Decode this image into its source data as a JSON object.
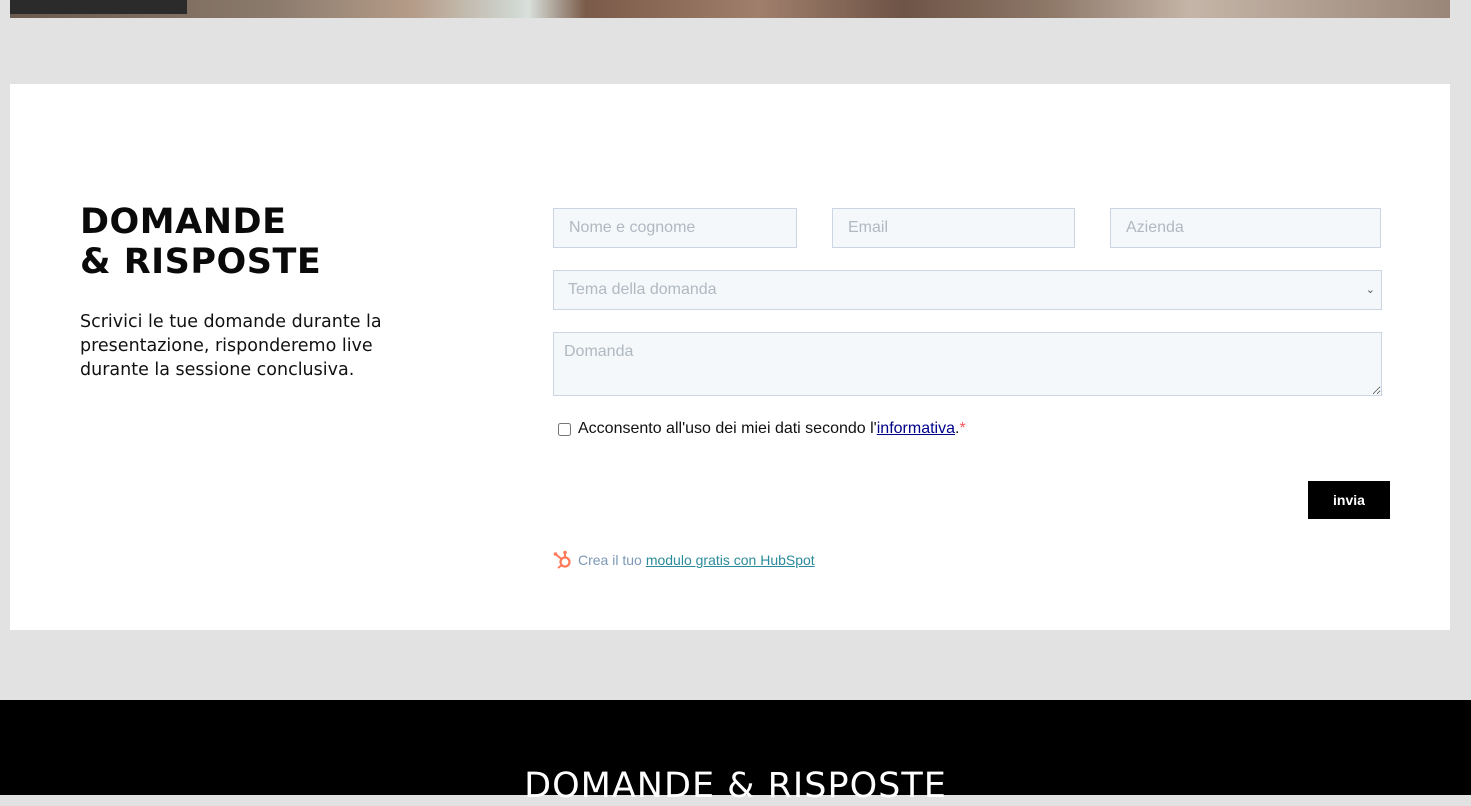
{
  "section": {
    "heading_line1": "DOMANDE",
    "heading_line2": "& RISPOSTE",
    "description": "Scrivici le tue domande durante la presentazione, risponderemo live durante la sessione conclusiva."
  },
  "form": {
    "name_placeholder": "Nome e cognome",
    "email_placeholder": "Email",
    "company_placeholder": "Azienda",
    "topic_placeholder": "Tema della domanda",
    "question_placeholder": "Domanda",
    "consent_text": "Acconsento all'uso dei miei dati secondo l'",
    "consent_link": "informativa",
    "consent_suffix": ".",
    "required_marker": "*",
    "submit_label": "invia"
  },
  "hubspot": {
    "prefix": "Crea il tuo",
    "link_text": "modulo gratis con HubSpot",
    "icon": "hubspot-sprocket-icon"
  },
  "footer": {
    "title": "DOMANDE & RISPOSTE"
  },
  "colors": {
    "field_bg": "#f5f8fa",
    "field_border": "#cbd6e2",
    "button_bg": "#000000",
    "hubspot_orange": "#ff7a59",
    "link_color": "#2a8b9a"
  }
}
